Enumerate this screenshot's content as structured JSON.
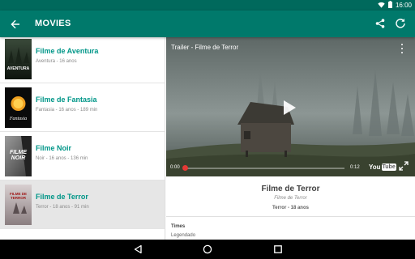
{
  "status_bar": {
    "time": "16:00",
    "icons": [
      "wifi-icon",
      "battery-icon"
    ]
  },
  "app_bar": {
    "title": "MOVIES",
    "back_icon": "arrow-back-icon",
    "actions": [
      "share-icon",
      "refresh-icon"
    ]
  },
  "movies": [
    {
      "title": "Filme de Aventura",
      "meta": "Aventura - 16 anos",
      "poster_text": "AVENTURA",
      "selected": false
    },
    {
      "title": "Filme de Fantasia",
      "meta": "Fantasia - 16 anos - 189 min",
      "poster_text": "Fantasia",
      "selected": false
    },
    {
      "title": "Filme Noir",
      "meta": "Noir - 16 anos - 136 min",
      "poster_text": "FILME NOIR",
      "selected": false
    },
    {
      "title": "Filme de Terror",
      "meta": "Terror - 18 anos - 91 min",
      "poster_text": "FILME DE TERROR",
      "selected": true
    }
  ],
  "player": {
    "title": "Trailer - Filme de Terror",
    "time_current": "0:00",
    "time_total": "0:12",
    "progress": 0,
    "logo_text_1": "You",
    "logo_text_2": "Tube"
  },
  "detail": {
    "title": "Filme de Terror",
    "subtitle": "Filme de Terror",
    "genre_line": "Terror - 18 anos",
    "section_label": "Times",
    "section_value": "Legendado"
  },
  "colors": {
    "primary": "#00796b",
    "primary_dark": "#00695c",
    "accent": "#009688",
    "progress": "#e53935"
  },
  "nav_bar": {
    "icons": [
      "nav-back-icon",
      "nav-home-icon",
      "nav-recents-icon"
    ]
  }
}
